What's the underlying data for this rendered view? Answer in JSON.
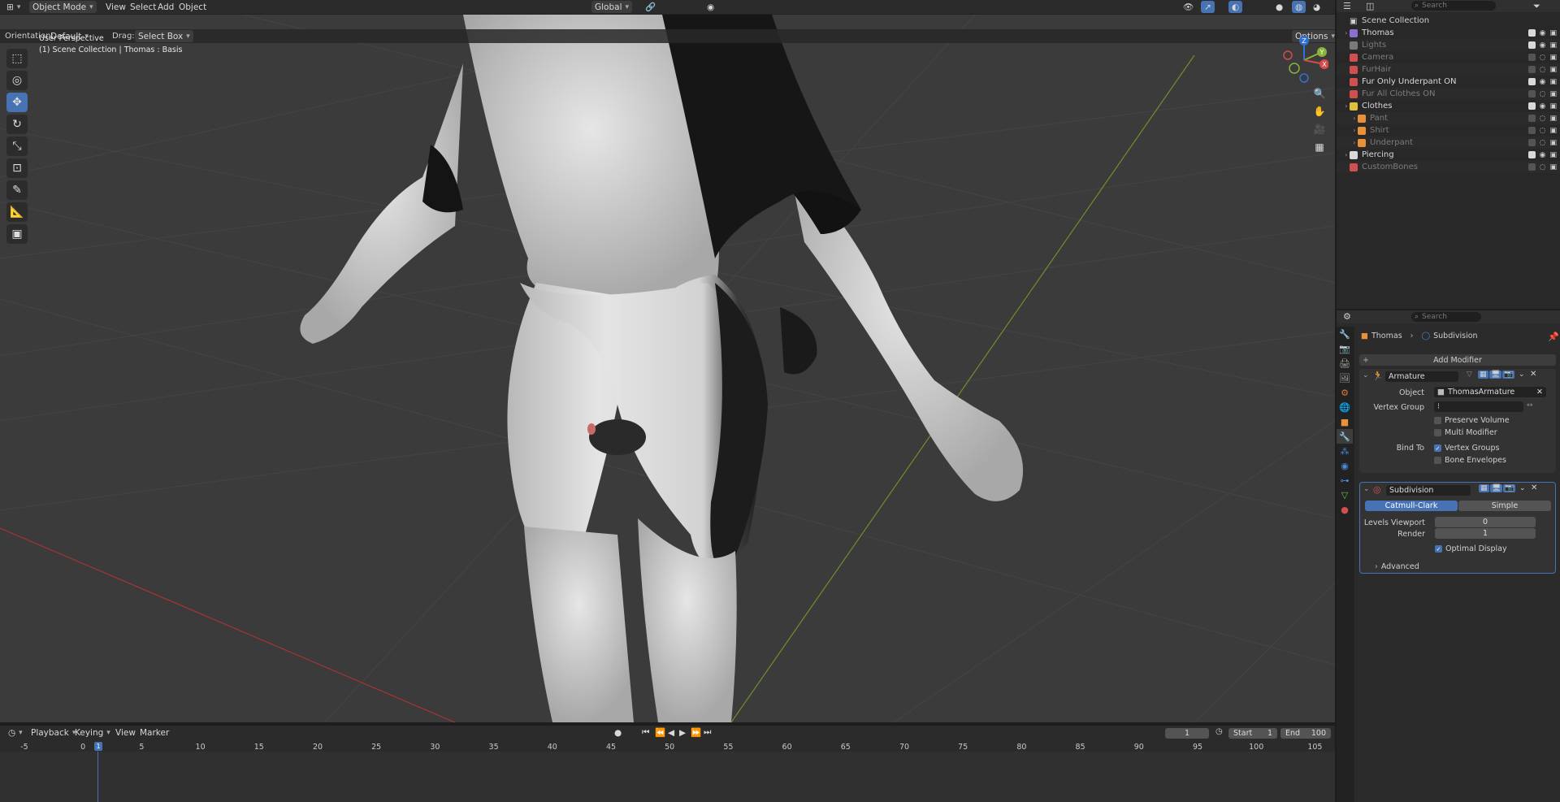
{
  "header": {
    "mode": "Object Mode",
    "menus": [
      "View",
      "Select",
      "Add",
      "Object"
    ],
    "transform_orientation": "Global",
    "search_placeholder": "Search"
  },
  "tool_settings": {
    "orientation_label": "Orientation:",
    "orientation_value": "Default",
    "drag_label": "Drag:",
    "drag_value": "Select Box",
    "options_label": "Options"
  },
  "viewport": {
    "view_name": "User Perspective",
    "view_context": "(1) Scene Collection | Thomas : Basis",
    "gizmo_axes": [
      "Z",
      "Y",
      "X"
    ]
  },
  "outliner": {
    "search_placeholder": "Search",
    "root": "Scene Collection",
    "items": [
      {
        "label": "Thomas",
        "enabled": true,
        "color": "#8a6fd1",
        "dim": false
      },
      {
        "label": "Lights",
        "enabled": true,
        "color": "#7a7a7a",
        "dim": true
      },
      {
        "label": "Camera",
        "enabled": false,
        "color": "#d05050",
        "dim": true
      },
      {
        "label": "FurHair",
        "enabled": false,
        "color": "#d05050",
        "dim": true
      },
      {
        "label": "Fur Only Underpant ON",
        "enabled": true,
        "color": "#d05050",
        "dim": false
      },
      {
        "label": "Fur All Clothes ON",
        "enabled": false,
        "color": "#d05050",
        "dim": true
      },
      {
        "label": "Clothes",
        "enabled": true,
        "color": "#e0c13b",
        "dim": false
      },
      {
        "label": "Pant",
        "enabled": false,
        "color": "#e8913a",
        "dim": true
      },
      {
        "label": "Shirt",
        "enabled": false,
        "color": "#e8913a",
        "dim": true
      },
      {
        "label": "Underpant",
        "enabled": false,
        "color": "#e8913a",
        "dim": true
      },
      {
        "label": "Piercing",
        "enabled": true,
        "color": "#d9d9d9",
        "dim": false
      },
      {
        "label": "CustomBones",
        "enabled": false,
        "color": "#d05050",
        "dim": true
      }
    ]
  },
  "properties": {
    "search_placeholder": "Search",
    "breadcrumb_object": "Thomas",
    "breadcrumb_modifier": "Subdivision",
    "add_modifier": "Add Modifier",
    "armature": {
      "name": "Armature",
      "object_label": "Object",
      "object_value": "ThomasArmature",
      "vertex_group_label": "Vertex Group",
      "preserve_volume": "Preserve Volume",
      "multi_modifier": "Multi Modifier",
      "bind_to_label": "Bind To",
      "vertex_groups": "Vertex Groups",
      "bone_envelopes": "Bone Envelopes"
    },
    "subdivision": {
      "name": "Subdivision",
      "catmull": "Catmull-Clark",
      "simple": "Simple",
      "levels_label": "Levels Viewport",
      "levels_value": "0",
      "render_label": "Render",
      "render_value": "1",
      "optimal_display": "Optimal Display",
      "advanced": "Advanced"
    }
  },
  "timeline": {
    "menus": [
      "Playback",
      "Keying",
      "View",
      "Marker"
    ],
    "current_frame": "1",
    "start_label": "Start",
    "start_value": "1",
    "end_label": "End",
    "end_value": "100",
    "ticks": [
      "-5",
      "0",
      "5",
      "10",
      "15",
      "20",
      "25",
      "30",
      "35",
      "40",
      "45",
      "50",
      "55",
      "60",
      "65",
      "70",
      "75",
      "80",
      "85",
      "90",
      "95",
      "100",
      "105"
    ],
    "playhead": "1"
  }
}
